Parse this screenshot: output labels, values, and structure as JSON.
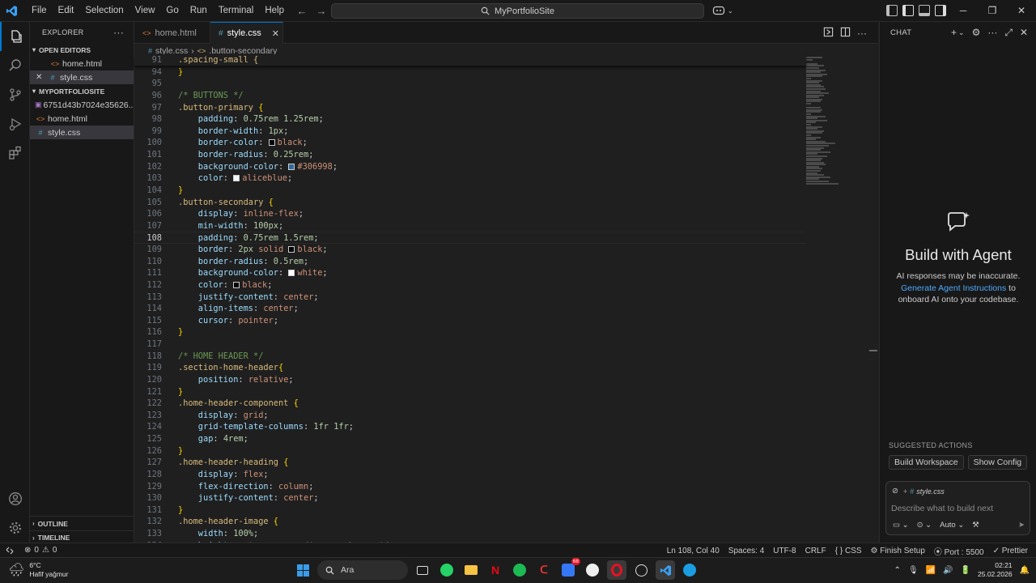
{
  "titlebar": {
    "menu": [
      "File",
      "Edit",
      "Selection",
      "View",
      "Go",
      "Run",
      "Terminal",
      "Help"
    ],
    "search_text": "MyPortfolioSite"
  },
  "explorer": {
    "title": "EXPLORER",
    "open_editors_label": "OPEN EDITORS",
    "open_editors": [
      {
        "name": "home.html",
        "type": "html"
      },
      {
        "name": "style.css",
        "type": "css"
      }
    ],
    "project_label": "MYPORTFOLIOSITE",
    "files": [
      {
        "name": "6751d43b7024e35626...",
        "type": "img"
      },
      {
        "name": "home.html",
        "type": "html"
      },
      {
        "name": "style.css",
        "type": "css"
      }
    ],
    "outline_label": "OUTLINE",
    "timeline_label": "TIMELINE"
  },
  "tabs": [
    {
      "label": "home.html",
      "type": "html"
    },
    {
      "label": "style.css",
      "type": "css"
    }
  ],
  "breadcrumb": {
    "file": "style.css",
    "symbol": ".button-secondary"
  },
  "editor": {
    "current_line": 108,
    "sticky": {
      "num": 91,
      "text": ".spacing-small {"
    },
    "lines": [
      {
        "n": 94,
        "code": [
          [
            "}",
            "brace"
          ]
        ]
      },
      {
        "n": 95,
        "code": []
      },
      {
        "n": 96,
        "code": [
          [
            "/* BUTTONS */",
            "com"
          ]
        ]
      },
      {
        "n": 97,
        "code": [
          [
            ".button-primary",
            "sel"
          ],
          [
            " {",
            "brace"
          ]
        ]
      },
      {
        "n": 98,
        "code": [
          [
            "    padding",
            "prop"
          ],
          [
            ": ",
            "punc"
          ],
          [
            "0.75rem 1.25rem",
            "num"
          ],
          [
            ";",
            "punc"
          ]
        ]
      },
      {
        "n": 99,
        "code": [
          [
            "    border-width",
            "prop"
          ],
          [
            ": ",
            "punc"
          ],
          [
            "1px",
            "num"
          ],
          [
            ";",
            "punc"
          ]
        ]
      },
      {
        "n": 100,
        "code": [
          [
            "    border-color",
            "prop"
          ],
          [
            ": ",
            "punc"
          ],
          [
            "#000000",
            "swatch"
          ],
          [
            "black",
            "val"
          ],
          [
            ";",
            "punc"
          ]
        ]
      },
      {
        "n": 101,
        "code": [
          [
            "    border-radius",
            "prop"
          ],
          [
            ": ",
            "punc"
          ],
          [
            "0.25rem",
            "num"
          ],
          [
            ";",
            "punc"
          ]
        ]
      },
      {
        "n": 102,
        "code": [
          [
            "    background-color",
            "prop"
          ],
          [
            ": ",
            "punc"
          ],
          [
            "#306998",
            "swatch"
          ],
          [
            "#306998",
            "val"
          ],
          [
            ";",
            "punc"
          ]
        ]
      },
      {
        "n": 103,
        "code": [
          [
            "    color",
            "prop"
          ],
          [
            ": ",
            "punc"
          ],
          [
            "#f0f8ff",
            "swatch"
          ],
          [
            "aliceblue",
            "val"
          ],
          [
            ";",
            "punc"
          ]
        ]
      },
      {
        "n": 104,
        "code": [
          [
            "}",
            "brace"
          ]
        ]
      },
      {
        "n": 105,
        "code": [
          [
            ".button-secondary",
            "sel"
          ],
          [
            " {",
            "brace"
          ]
        ]
      },
      {
        "n": 106,
        "code": [
          [
            "    display",
            "prop"
          ],
          [
            ": ",
            "punc"
          ],
          [
            "inline-flex",
            "val"
          ],
          [
            ";",
            "punc"
          ]
        ]
      },
      {
        "n": 107,
        "code": [
          [
            "    min-width",
            "prop"
          ],
          [
            ": ",
            "punc"
          ],
          [
            "100px",
            "num"
          ],
          [
            ";",
            "punc"
          ]
        ]
      },
      {
        "n": 108,
        "code": [
          [
            "    padding",
            "prop"
          ],
          [
            ": ",
            "punc"
          ],
          [
            "0.75rem 1.5rem",
            "num"
          ],
          [
            ";",
            "punc"
          ]
        ]
      },
      {
        "n": 109,
        "code": [
          [
            "    border",
            "prop"
          ],
          [
            ": ",
            "punc"
          ],
          [
            "2px ",
            "num"
          ],
          [
            "solid ",
            "val"
          ],
          [
            "#000000",
            "swatch"
          ],
          [
            "black",
            "val"
          ],
          [
            ";",
            "punc"
          ]
        ]
      },
      {
        "n": 110,
        "code": [
          [
            "    border-radius",
            "prop"
          ],
          [
            ": ",
            "punc"
          ],
          [
            "0.5rem",
            "num"
          ],
          [
            ";",
            "punc"
          ]
        ]
      },
      {
        "n": 111,
        "code": [
          [
            "    background-color",
            "prop"
          ],
          [
            ": ",
            "punc"
          ],
          [
            "#ffffff",
            "swatch"
          ],
          [
            "white",
            "val"
          ],
          [
            ";",
            "punc"
          ]
        ]
      },
      {
        "n": 112,
        "code": [
          [
            "    color",
            "prop"
          ],
          [
            ": ",
            "punc"
          ],
          [
            "#000000",
            "swatch"
          ],
          [
            "black",
            "val"
          ],
          [
            ";",
            "punc"
          ]
        ]
      },
      {
        "n": 113,
        "code": [
          [
            "    justify-content",
            "prop"
          ],
          [
            ": ",
            "punc"
          ],
          [
            "center",
            "val"
          ],
          [
            ";",
            "punc"
          ]
        ]
      },
      {
        "n": 114,
        "code": [
          [
            "    align-items",
            "prop"
          ],
          [
            ": ",
            "punc"
          ],
          [
            "center",
            "val"
          ],
          [
            ";",
            "punc"
          ]
        ]
      },
      {
        "n": 115,
        "code": [
          [
            "    cursor",
            "prop"
          ],
          [
            ": ",
            "punc"
          ],
          [
            "pointer",
            "val"
          ],
          [
            ";",
            "punc"
          ]
        ]
      },
      {
        "n": 116,
        "code": [
          [
            "}",
            "brace"
          ]
        ]
      },
      {
        "n": 117,
        "code": []
      },
      {
        "n": 118,
        "code": [
          [
            "/* HOME HEADER */",
            "com"
          ]
        ]
      },
      {
        "n": 119,
        "code": [
          [
            ".section-home-header",
            "sel"
          ],
          [
            "{",
            "brace"
          ]
        ]
      },
      {
        "n": 120,
        "code": [
          [
            "    position",
            "prop"
          ],
          [
            ": ",
            "punc"
          ],
          [
            "relative",
            "val"
          ],
          [
            ";",
            "punc"
          ]
        ]
      },
      {
        "n": 121,
        "code": [
          [
            "}",
            "brace"
          ]
        ]
      },
      {
        "n": 122,
        "code": [
          [
            ".home-header-component",
            "sel"
          ],
          [
            " {",
            "brace"
          ]
        ]
      },
      {
        "n": 123,
        "code": [
          [
            "    display",
            "prop"
          ],
          [
            ": ",
            "punc"
          ],
          [
            "grid",
            "val"
          ],
          [
            ";",
            "punc"
          ]
        ]
      },
      {
        "n": 124,
        "code": [
          [
            "    grid-template-columns",
            "prop"
          ],
          [
            ": ",
            "punc"
          ],
          [
            "1fr 1fr",
            "num"
          ],
          [
            ";",
            "punc"
          ]
        ]
      },
      {
        "n": 125,
        "code": [
          [
            "    gap",
            "prop"
          ],
          [
            ": ",
            "punc"
          ],
          [
            "4rem",
            "num"
          ],
          [
            ";",
            "punc"
          ]
        ]
      },
      {
        "n": 126,
        "code": [
          [
            "}",
            "brace"
          ]
        ]
      },
      {
        "n": 127,
        "code": [
          [
            ".home-header-heading",
            "sel"
          ],
          [
            " {",
            "brace"
          ]
        ]
      },
      {
        "n": 128,
        "code": [
          [
            "    display",
            "prop"
          ],
          [
            ": ",
            "punc"
          ],
          [
            "flex",
            "val"
          ],
          [
            ";",
            "punc"
          ]
        ]
      },
      {
        "n": 129,
        "code": [
          [
            "    flex-direction",
            "prop"
          ],
          [
            ": ",
            "punc"
          ],
          [
            "column",
            "val"
          ],
          [
            ";",
            "punc"
          ]
        ]
      },
      {
        "n": 130,
        "code": [
          [
            "    justify-content",
            "prop"
          ],
          [
            ": ",
            "punc"
          ],
          [
            "center",
            "val"
          ],
          [
            ";",
            "punc"
          ]
        ]
      },
      {
        "n": 131,
        "code": [
          [
            "}",
            "brace"
          ]
        ]
      },
      {
        "n": 132,
        "code": [
          [
            ".home-header-image",
            "sel"
          ],
          [
            " {",
            "brace"
          ]
        ]
      },
      {
        "n": 133,
        "code": [
          [
            "    width",
            "prop"
          ],
          [
            ": ",
            "punc"
          ],
          [
            "100%",
            "num"
          ],
          [
            ";",
            "punc"
          ]
        ]
      },
      {
        "n": 134,
        "code": [
          [
            "    height",
            "prop"
          ],
          [
            ": ",
            "punc"
          ],
          [
            "auto",
            "val"
          ],
          [
            ";",
            "punc"
          ],
          [
            "        /* epeno korun */",
            "com"
          ]
        ]
      }
    ]
  },
  "chat": {
    "header": "CHAT",
    "title": "Build with Agent",
    "sub1": "AI responses may be inaccurate.",
    "link": "Generate Agent Instructions",
    "sub2_tail": " to",
    "sub3": "onboard AI onto your codebase.",
    "suggested_label": "SUGGESTED ACTIONS",
    "suggested": [
      "Build Workspace",
      "Show Config"
    ],
    "context_file": "style.css",
    "placeholder": "Describe what to build next",
    "mode": "Auto"
  },
  "statusbar": {
    "errors": "0",
    "warnings": "0",
    "position": "Ln 108, Col 40",
    "spaces": "Spaces: 4",
    "encoding": "UTF-8",
    "eol": "CRLF",
    "language": "CSS",
    "finish_setup": "Finish Setup",
    "port": "Port : 5500",
    "prettier": "Prettier"
  },
  "taskbar": {
    "temperature": "6°C",
    "weather": "Hafif yağmur",
    "search": "Ara",
    "mail_badge": "68",
    "time": "02:21",
    "date": "25.02.2026"
  },
  "colors": {
    "accent": "#0078d4",
    "link": "#4daafc"
  }
}
